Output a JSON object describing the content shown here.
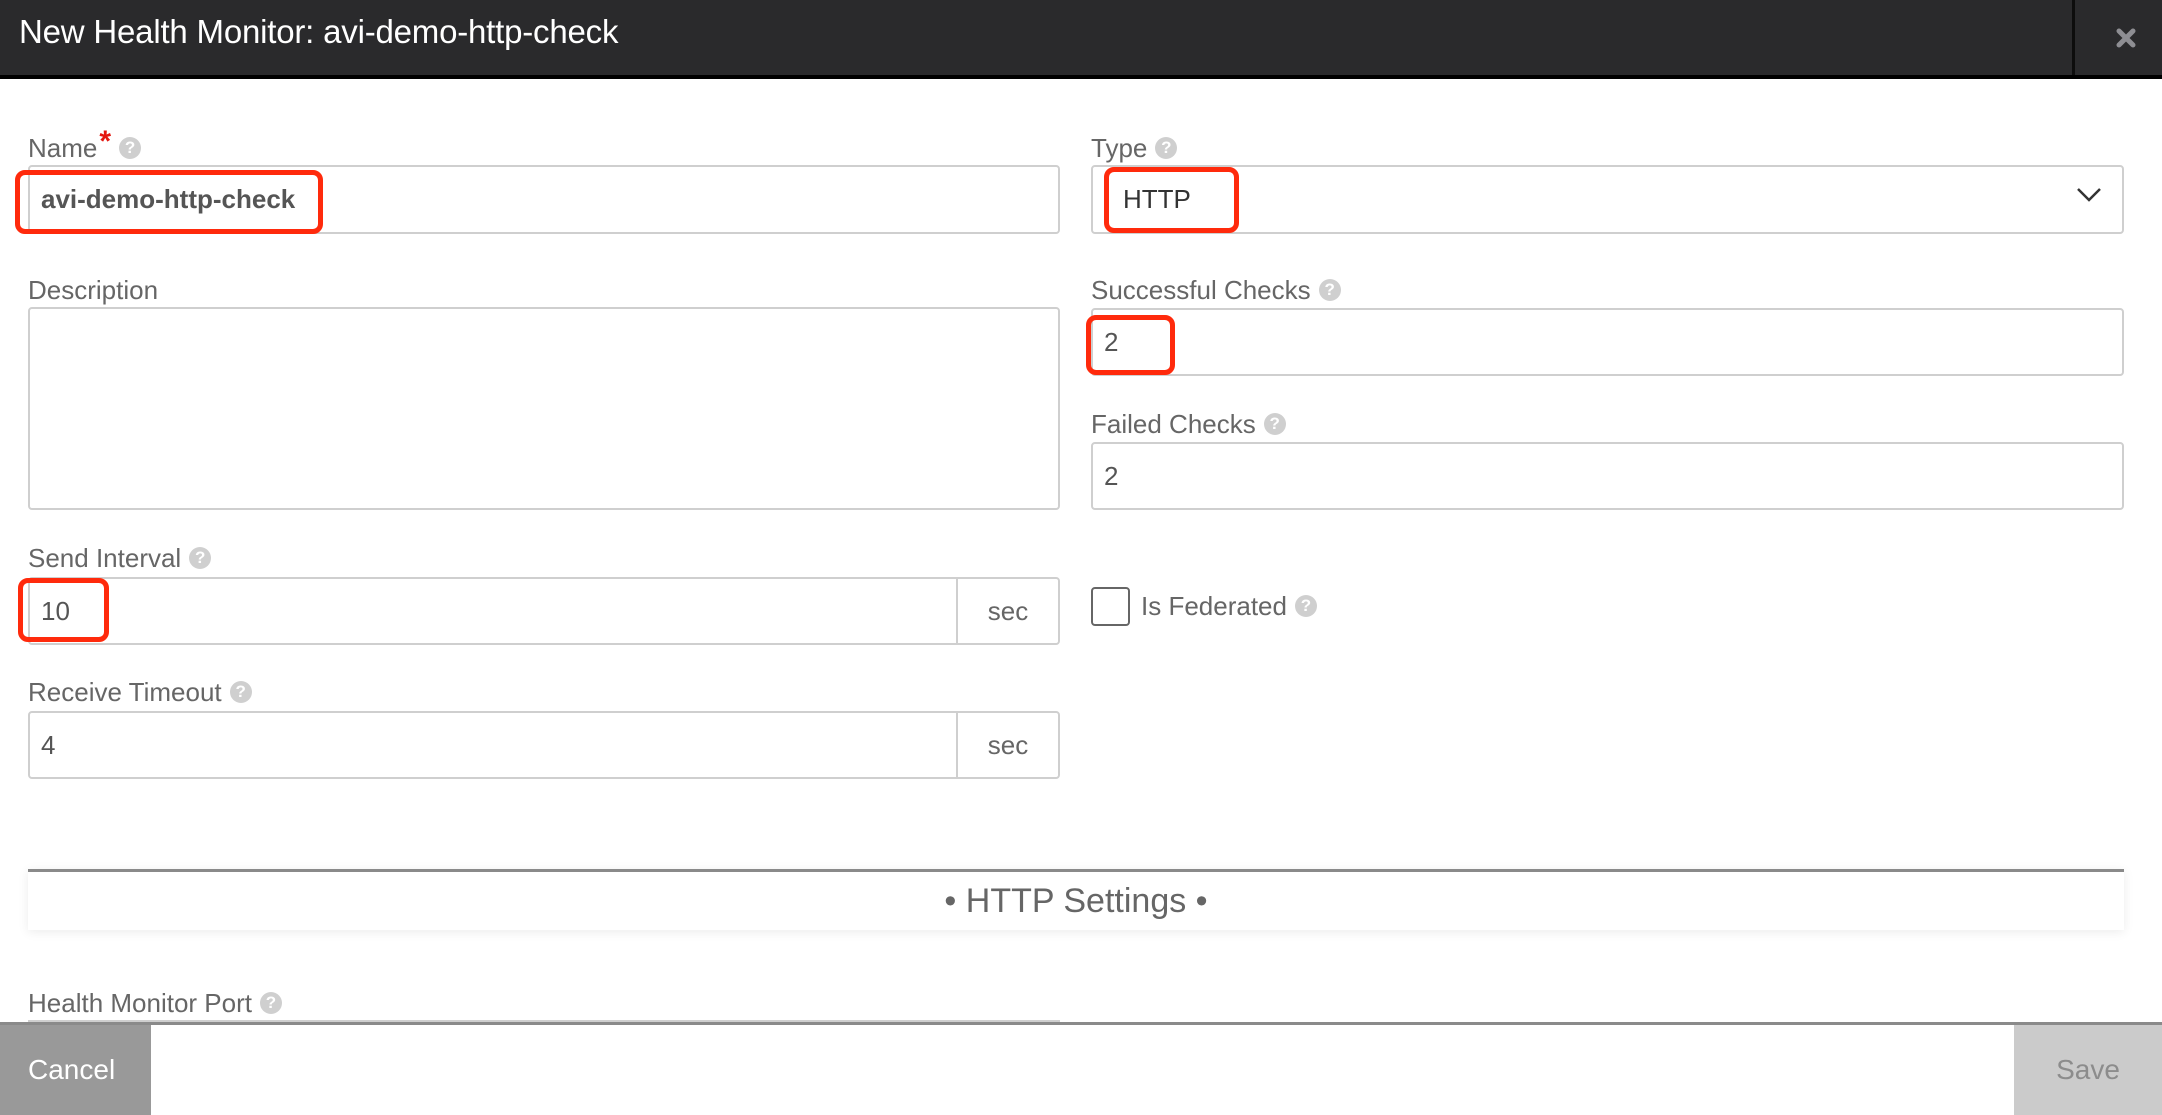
{
  "header": {
    "title": "New Health Monitor: avi-demo-http-check",
    "close_icon": "close-icon"
  },
  "form": {
    "name": {
      "label": "Name",
      "required_mark": "*",
      "value": "avi-demo-http-check",
      "help": "?"
    },
    "type": {
      "label": "Type",
      "value": "HTTP",
      "help": "?"
    },
    "description": {
      "label": "Description",
      "value": ""
    },
    "successful_checks": {
      "label": "Successful Checks",
      "value": "2",
      "help": "?"
    },
    "failed_checks": {
      "label": "Failed Checks",
      "value": "2",
      "help": "?"
    },
    "send_interval": {
      "label": "Send Interval",
      "value": "10",
      "unit": "sec",
      "help": "?"
    },
    "receive_timeout": {
      "label": "Receive Timeout",
      "value": "4",
      "unit": "sec",
      "help": "?"
    },
    "is_federated": {
      "label": "Is Federated",
      "checked": false,
      "help": "?"
    },
    "health_monitor_port": {
      "label": "Health Monitor Port",
      "help": "?"
    }
  },
  "sections": {
    "http_settings": "• HTTP Settings •"
  },
  "footer": {
    "cancel_label": "Cancel",
    "save_label": "Save"
  },
  "colors": {
    "header_bg": "#2a2a2c",
    "highlight": "#ff2a0c",
    "required": "#e4170f",
    "cancel_bg": "#999999",
    "save_bg": "#cbcbcb"
  }
}
